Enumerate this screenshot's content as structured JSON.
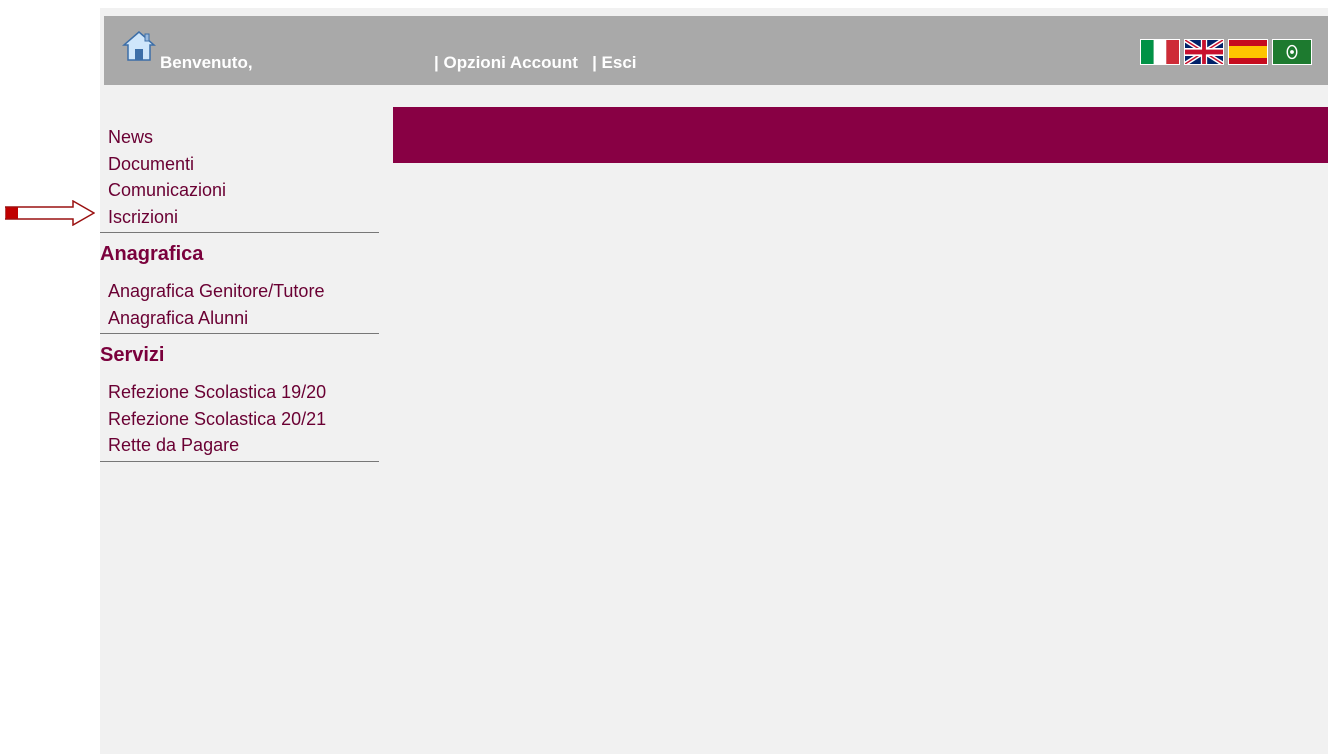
{
  "header": {
    "welcome": "Benvenuto,",
    "links": "| Opzioni Account   | Esci",
    "account_options": "| Opzioni Account",
    "logout": "| Esci",
    "languages": [
      "italian-flag",
      "uk-flag",
      "spanish-flag",
      "arabic-flag"
    ]
  },
  "sidebar": {
    "top_items": [
      "News",
      "Documenti",
      "Comunicazioni",
      "Iscrizioni"
    ],
    "anagrafica": {
      "title": "Anagrafica",
      "items": [
        "Anagrafica Genitore/Tutore",
        "Anagrafica Alunni"
      ]
    },
    "servizi": {
      "title": "Servizi",
      "items": [
        "Refezione Scolastica 19/20",
        "Refezione Scolastica 20/21",
        "Rette da Pagare"
      ]
    }
  },
  "colors": {
    "accent": "#880044",
    "header_bg": "#a9a9a9",
    "page_bg": "#f1f1f1",
    "arrow": "#c00000"
  }
}
